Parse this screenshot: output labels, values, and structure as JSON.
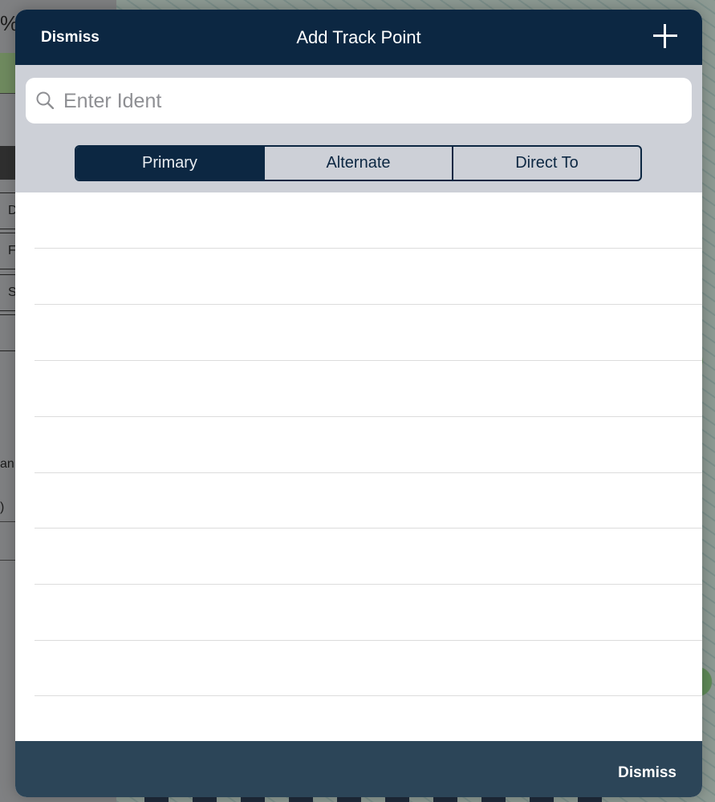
{
  "background": {
    "left_panel_text": [
      "%",
      "D",
      "F",
      "S",
      "an",
      ")"
    ]
  },
  "modal": {
    "dismiss_top_label": "Dismiss",
    "title": "Add Track Point",
    "add_icon": "plus-icon",
    "search": {
      "placeholder": "Enter Ident",
      "value": "",
      "icon": "search-icon"
    },
    "segments": [
      {
        "label": "Primary",
        "active": true
      },
      {
        "label": "Alternate",
        "active": false
      },
      {
        "label": "Direct To",
        "active": false
      }
    ],
    "dismiss_bottom_label": "Dismiss"
  },
  "colors": {
    "nav_background": "#0c2742",
    "toolbar_background": "#cdd0d7",
    "footer_background": "#2c4558",
    "segment_active": "#0c2742"
  }
}
